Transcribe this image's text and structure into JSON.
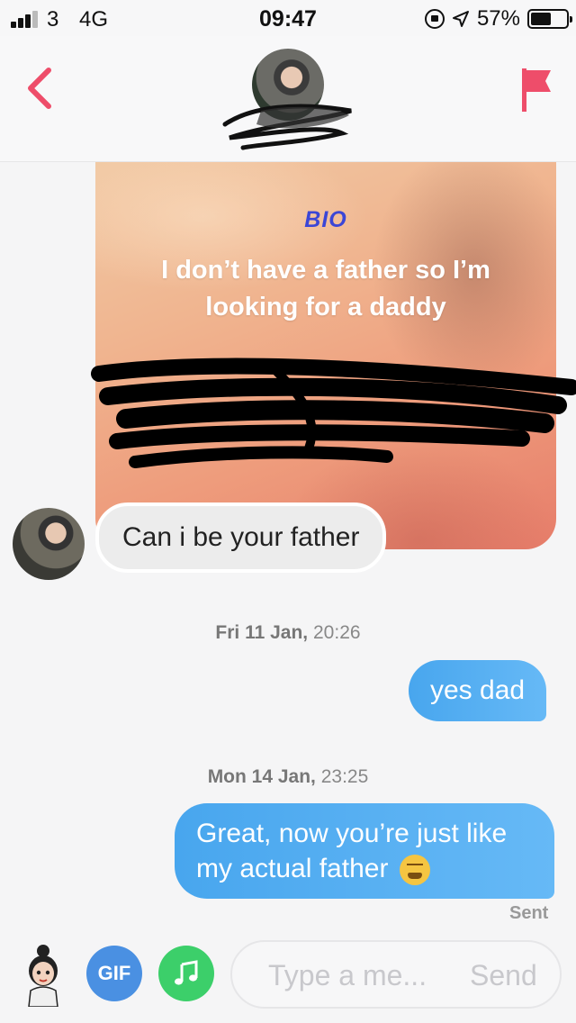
{
  "status_bar": {
    "carrier": "3",
    "network": "4G",
    "time": "09:47",
    "battery_percent": "57%",
    "battery_level": 0.57
  },
  "header": {
    "back_icon": "chevron-left-icon",
    "flag_icon": "flag-icon",
    "accent_color": "#ee4d6a"
  },
  "bio": {
    "label": "BIO",
    "text": "I don’t have a father so I’m looking for a daddy"
  },
  "messages": {
    "incoming_1": "Can i be your father",
    "timestamp_1_day": "Fri 11 Jan,",
    "timestamp_1_time": "20:26",
    "outgoing_1": "yes dad",
    "timestamp_2_day": "Mon 14 Jan,",
    "timestamp_2_time": "23:25",
    "outgoing_2": "Great, now you’re just like my actual father",
    "outgoing_2_emoji": "tired-face-emoji",
    "status": "Sent"
  },
  "composer": {
    "gif_label": "GIF",
    "placeholder": "Type a me...",
    "send_label": "Send"
  }
}
